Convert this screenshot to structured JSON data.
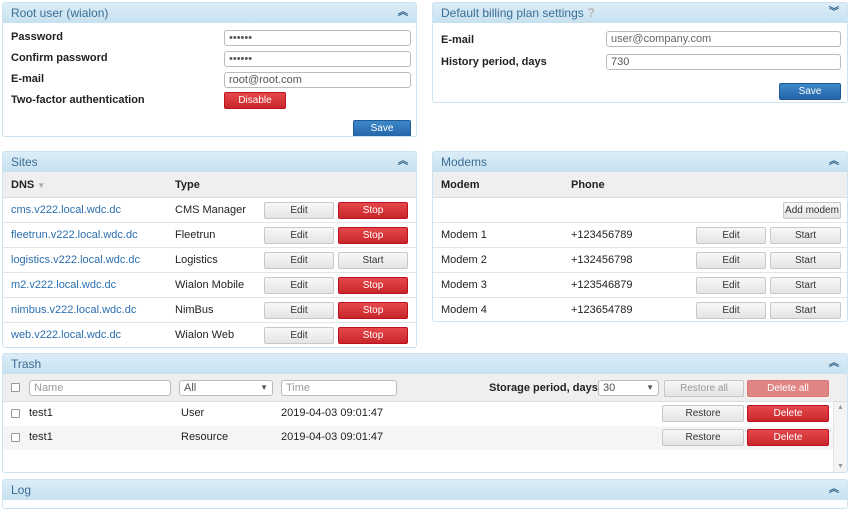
{
  "root_user": {
    "title": "Root user (wialon)",
    "password_label": "Password",
    "password_value": "••••••",
    "confirm_label": "Confirm password",
    "confirm_value": "••••••",
    "email_label": "E-mail",
    "email_value": "root@root.com",
    "twofa_label": "Two-factor authentication",
    "disable_label": "Disable",
    "save_label": "Save"
  },
  "billing": {
    "title": "Default billing plan settings",
    "help": "?",
    "email_label": "E-mail",
    "email_placeholder": "user@company.com",
    "history_label": "History period, days",
    "history_value": "730",
    "save_label": "Save"
  },
  "sites": {
    "title": "Sites",
    "col_dns": "DNS",
    "col_type": "Type",
    "edit_label": "Edit",
    "rows": [
      {
        "dns": "cms.v222.local.wdc.dc",
        "type": "CMS Manager",
        "action": "Stop"
      },
      {
        "dns": "fleetrun.v222.local.wdc.dc",
        "type": "Fleetrun",
        "action": "Stop"
      },
      {
        "dns": "logistics.v222.local.wdc.dc",
        "type": "Logistics",
        "action": "Start"
      },
      {
        "dns": "m2.v222.local.wdc.dc",
        "type": "Wialon Mobile",
        "action": "Stop"
      },
      {
        "dns": "nimbus.v222.local.wdc.dc",
        "type": "NimBus",
        "action": "Stop"
      },
      {
        "dns": "web.v222.local.wdc.dc",
        "type": "Wialon Web",
        "action": "Stop"
      }
    ]
  },
  "modems": {
    "title": "Modems",
    "col_modem": "Modem",
    "col_phone": "Phone",
    "add_label": "Add modem",
    "edit_label": "Edit",
    "rows": [
      {
        "name": "Modem 1",
        "phone": "+123456789",
        "action": "Start"
      },
      {
        "name": "Modem 2",
        "phone": "+132456798",
        "action": "Start"
      },
      {
        "name": "Modem 3",
        "phone": "+123546879",
        "action": "Start"
      },
      {
        "name": "Modem 4",
        "phone": "+123654789",
        "action": "Start"
      }
    ]
  },
  "trash": {
    "title": "Trash",
    "name_placeholder": "Name",
    "type_filter": "All",
    "time_placeholder": "Time",
    "storage_label": "Storage period, days:",
    "storage_value": "30",
    "restore_all": "Restore all",
    "delete_all": "Delete all",
    "restore_label": "Restore",
    "delete_label": "Delete",
    "rows": [
      {
        "name": "test1",
        "type": "User",
        "time": "2019-04-03 09:01:47"
      },
      {
        "name": "test1",
        "type": "Resource",
        "time": "2019-04-03 09:01:47"
      }
    ]
  },
  "log": {
    "title": "Log"
  },
  "colors": {
    "header": "#c7e1f0",
    "danger": "#c8262a",
    "primary": "#2465a8",
    "link": "#2a6fb0"
  }
}
